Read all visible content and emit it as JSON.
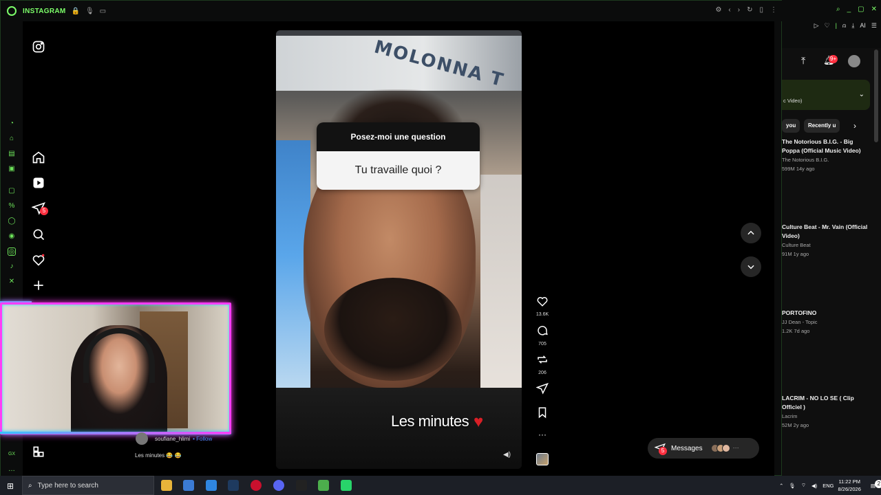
{
  "browser": {
    "title": "INSTAGRAM",
    "accent": "#7dff6a"
  },
  "ig_nav": {
    "items": [
      "home-icon",
      "reels-icon",
      "direct-icon",
      "search-icon",
      "notifications-icon",
      "create-icon"
    ],
    "direct_badge": "5"
  },
  "reel": {
    "sign_text": "MOLONNA T",
    "question_title": "Posez-moi une question",
    "question_answer": "Tu travaille quoi ?",
    "caption": "Les minutes",
    "likes": "13.6K",
    "comments": "705",
    "reposts": "206"
  },
  "messages": {
    "label": "Messages",
    "badge": "5"
  },
  "chat": {
    "username": "soufiane_hlimi",
    "follow": "• Follow",
    "message": "Les minutes 😂 😂"
  },
  "youtube": {
    "mix_label": "c Video)",
    "chips": [
      "you",
      "Recently u"
    ],
    "videos": [
      {
        "title": "The Notorious B.I.G. - Big Poppa (Official Music Video)",
        "channel": "The Notorious B.I.G.",
        "meta": "599M  14y ago"
      },
      {
        "title": "Culture Beat - Mr. Vain (Official Video)",
        "channel": "Culture Beat",
        "meta": "91M  1y ago"
      },
      {
        "title": "PORTOFINO",
        "channel": "JJ Dean - Topic",
        "meta": "1.2K  7d ago"
      },
      {
        "title": "LACRIM - NO LO SE ( Clip Officiel )",
        "channel": "Lacrim",
        "meta": "52M  2y ago"
      }
    ],
    "notif_badge": "9+"
  },
  "taskbar": {
    "search_placeholder": "Type here to search",
    "lang": "ENG",
    "time": "11:22 PM",
    "date": "8/26/2026",
    "notif_count": "2"
  },
  "sidebar_bottom": "GX"
}
